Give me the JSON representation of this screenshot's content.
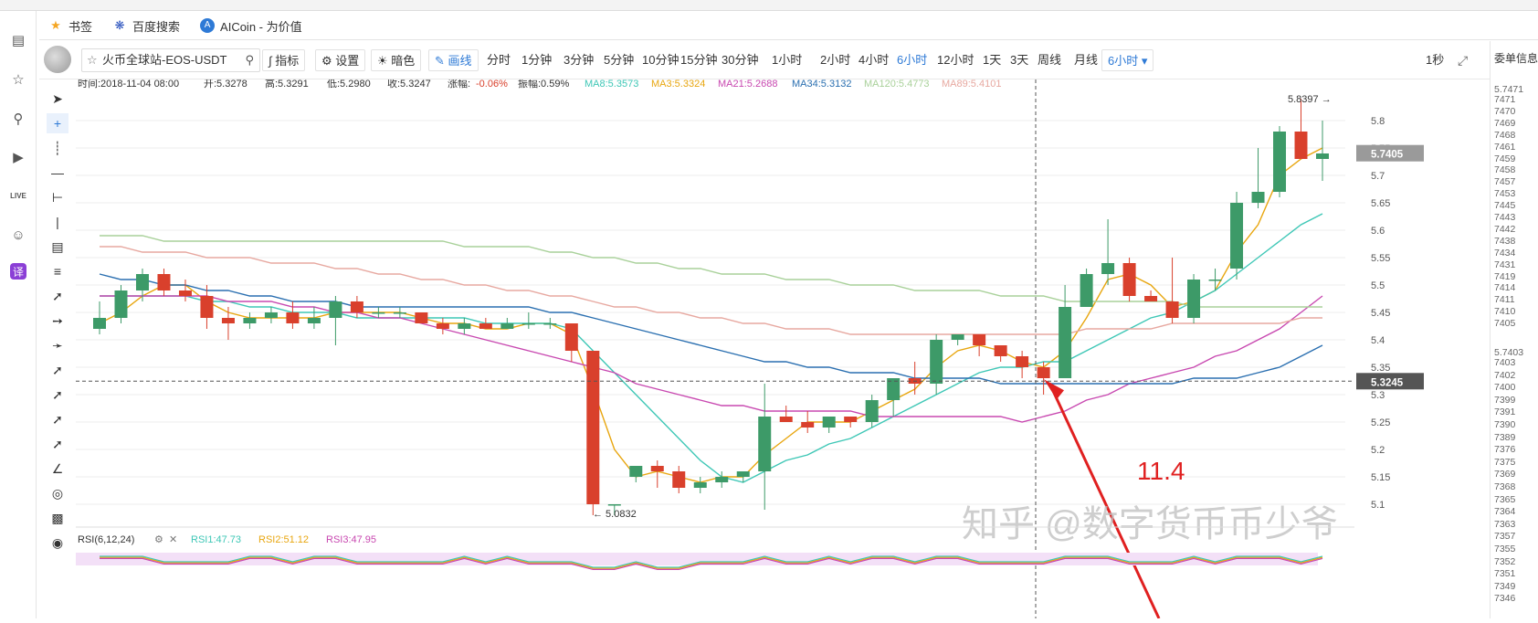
{
  "bookmarks": [
    {
      "label": "书签",
      "icon": "star-icon"
    },
    {
      "label": "百度搜索",
      "icon": "baidu-paw-icon"
    },
    {
      "label": "AICoin - 为价值",
      "icon": "aicoin-logo-icon"
    }
  ],
  "sidebar_icons": [
    "reader-icon",
    "favorites-star-icon",
    "search-icon",
    "video-icon",
    "live-icon",
    "chat-icon",
    "translate-icon"
  ],
  "toolbar": {
    "symbol": "火币全球站-EOS-USDT",
    "indicators": "指标",
    "settings": "设置",
    "theme": "暗色",
    "draw": "画线",
    "intervals": [
      "分时",
      "1分钟",
      "3分钟",
      "5分钟",
      "10分钟",
      "15分钟",
      "30分钟",
      "1小时",
      "2小时",
      "4小时",
      "6小时",
      "12小时",
      "1天",
      "3天",
      "周线",
      "月线"
    ],
    "active_interval": "6小时",
    "interval_dropdown": "6小时",
    "refresh": "1秒"
  },
  "right_panel": {
    "title": "委单信息",
    "sell_values": [
      "7471",
      "7470",
      "7469",
      "7468",
      "7461",
      "7459",
      "7458",
      "7457",
      "7453",
      "7445",
      "7443",
      "7442",
      "7438",
      "7434",
      "7431",
      "7419",
      "7414",
      "7411",
      "7410",
      "7405"
    ],
    "buy_values": [
      "7403",
      "7402",
      "7400",
      "7399",
      "7391",
      "7390",
      "7389",
      "7376",
      "7375",
      "7369",
      "7368",
      "7365",
      "7364",
      "7363",
      "7357",
      "7355",
      "7352",
      "7351",
      "7349",
      "7346"
    ],
    "top_price": "5.7471",
    "mid_price": "5.7403"
  },
  "info_bar": {
    "time": "时间:2018-11-04 08:00",
    "open": "开:5.3278",
    "high": "高:5.3291",
    "low": "低:5.2980",
    "close": "收:5.3247",
    "change_label": "涨幅:",
    "change_value": "-0.06%",
    "amplitude": "振幅:0.59%",
    "ma8": "MA8:5.3573",
    "ma3": "MA3:5.3324",
    "ma21": "MA21:5.2688",
    "ma34": "MA34:5.3132",
    "ma120": "MA120:5.4773",
    "ma89": "MA89:5.4101"
  },
  "annotations": {
    "high_marker": "5.8397 →",
    "low_marker": "← 5.0832",
    "hand_text": "11.4",
    "watermark": "知乎 @数字货币币少爷",
    "last_price": "5.7405",
    "cursor_price": "5.3245"
  },
  "rsi": {
    "label": "RSI(6,12,24)",
    "rsi1": "RSI1:47.73",
    "rsi2": "RSI2:51.12",
    "rsi3": "RSI3:47.95"
  },
  "colors": {
    "up": "#3d9a68",
    "down": "#d9402c",
    "ma3": "#e8a60f",
    "ma8": "#3ec7b6",
    "ma21": "#c848b0",
    "ma34": "#2a6fb0",
    "ma120": "#a9d19a",
    "ma89": "#e7a8a0",
    "arrow": "#e02020",
    "accent": "#2e7ad6"
  },
  "chart_data": {
    "type": "candlestick",
    "symbol": "EOS-USDT",
    "interval": "6小时",
    "y_ticks": [
      "5.8",
      "5.75",
      "5.7",
      "5.65",
      "5.6",
      "5.55",
      "5.5",
      "5.45",
      "5.4",
      "5.35",
      "5.3",
      "5.25",
      "5.2",
      "5.15",
      "5.1"
    ],
    "ylim": [
      5.08,
      5.85
    ],
    "candles": [
      {
        "o": 5.42,
        "h": 5.47,
        "l": 5.41,
        "c": 5.44
      },
      {
        "o": 5.44,
        "h": 5.5,
        "l": 5.43,
        "c": 5.49
      },
      {
        "o": 5.49,
        "h": 5.53,
        "l": 5.47,
        "c": 5.52
      },
      {
        "o": 5.52,
        "h": 5.53,
        "l": 5.48,
        "c": 5.49
      },
      {
        "o": 5.49,
        "h": 5.51,
        "l": 5.47,
        "c": 5.48
      },
      {
        "o": 5.48,
        "h": 5.5,
        "l": 5.42,
        "c": 5.44
      },
      {
        "o": 5.44,
        "h": 5.46,
        "l": 5.4,
        "c": 5.43
      },
      {
        "o": 5.43,
        "h": 5.45,
        "l": 5.42,
        "c": 5.44
      },
      {
        "o": 5.44,
        "h": 5.46,
        "l": 5.43,
        "c": 5.45
      },
      {
        "o": 5.45,
        "h": 5.47,
        "l": 5.42,
        "c": 5.43
      },
      {
        "o": 5.43,
        "h": 5.46,
        "l": 5.42,
        "c": 5.44
      },
      {
        "o": 5.44,
        "h": 5.48,
        "l": 5.39,
        "c": 5.47
      },
      {
        "o": 5.47,
        "h": 5.48,
        "l": 5.44,
        "c": 5.45
      },
      {
        "o": 5.45,
        "h": 5.46,
        "l": 5.44,
        "c": 5.45
      },
      {
        "o": 5.45,
        "h": 5.46,
        "l": 5.44,
        "c": 5.45
      },
      {
        "o": 5.45,
        "h": 5.45,
        "l": 5.43,
        "c": 5.43
      },
      {
        "o": 5.43,
        "h": 5.44,
        "l": 5.41,
        "c": 5.42
      },
      {
        "o": 5.42,
        "h": 5.44,
        "l": 5.41,
        "c": 5.43
      },
      {
        "o": 5.43,
        "h": 5.44,
        "l": 5.42,
        "c": 5.42
      },
      {
        "o": 5.42,
        "h": 5.44,
        "l": 5.42,
        "c": 5.43
      },
      {
        "o": 5.43,
        "h": 5.45,
        "l": 5.42,
        "c": 5.43
      },
      {
        "o": 5.43,
        "h": 5.44,
        "l": 5.42,
        "c": 5.43
      },
      {
        "o": 5.43,
        "h": 5.43,
        "l": 5.36,
        "c": 5.38
      },
      {
        "o": 5.38,
        "h": 5.38,
        "l": 5.08,
        "c": 5.1
      },
      {
        "o": 5.1,
        "h": 5.1,
        "l": 5.08,
        "c": 5.1
      },
      {
        "o": 5.15,
        "h": 5.17,
        "l": 5.14,
        "c": 5.17
      },
      {
        "o": 5.17,
        "h": 5.18,
        "l": 5.13,
        "c": 5.16
      },
      {
        "o": 5.16,
        "h": 5.17,
        "l": 5.12,
        "c": 5.13
      },
      {
        "o": 5.13,
        "h": 5.15,
        "l": 5.12,
        "c": 5.14
      },
      {
        "o": 5.14,
        "h": 5.16,
        "l": 5.13,
        "c": 5.15
      },
      {
        "o": 5.15,
        "h": 5.16,
        "l": 5.14,
        "c": 5.16
      },
      {
        "o": 5.16,
        "h": 5.32,
        "l": 5.09,
        "c": 5.26
      },
      {
        "o": 5.26,
        "h": 5.28,
        "l": 5.25,
        "c": 5.25
      },
      {
        "o": 5.25,
        "h": 5.27,
        "l": 5.23,
        "c": 5.24
      },
      {
        "o": 5.24,
        "h": 5.26,
        "l": 5.23,
        "c": 5.26
      },
      {
        "o": 5.26,
        "h": 5.26,
        "l": 5.24,
        "c": 5.25
      },
      {
        "o": 5.25,
        "h": 5.3,
        "l": 5.24,
        "c": 5.29
      },
      {
        "o": 5.29,
        "h": 5.33,
        "l": 5.26,
        "c": 5.33
      },
      {
        "o": 5.33,
        "h": 5.36,
        "l": 5.3,
        "c": 5.32
      },
      {
        "o": 5.32,
        "h": 5.41,
        "l": 5.3,
        "c": 5.4
      },
      {
        "o": 5.4,
        "h": 5.41,
        "l": 5.39,
        "c": 5.41
      },
      {
        "o": 5.41,
        "h": 5.41,
        "l": 5.37,
        "c": 5.39
      },
      {
        "o": 5.39,
        "h": 5.39,
        "l": 5.36,
        "c": 5.37
      },
      {
        "o": 5.37,
        "h": 5.38,
        "l": 5.33,
        "c": 5.35
      },
      {
        "o": 5.35,
        "h": 5.36,
        "l": 5.3,
        "c": 5.33
      },
      {
        "o": 5.33,
        "h": 5.5,
        "l": 5.33,
        "c": 5.46
      },
      {
        "o": 5.46,
        "h": 5.53,
        "l": 5.46,
        "c": 5.52
      },
      {
        "o": 5.52,
        "h": 5.62,
        "l": 5.5,
        "c": 5.54
      },
      {
        "o": 5.54,
        "h": 5.55,
        "l": 5.47,
        "c": 5.48
      },
      {
        "o": 5.48,
        "h": 5.49,
        "l": 5.47,
        "c": 5.47
      },
      {
        "o": 5.47,
        "h": 5.55,
        "l": 5.43,
        "c": 5.44
      },
      {
        "o": 5.44,
        "h": 5.52,
        "l": 5.43,
        "c": 5.51
      },
      {
        "o": 5.51,
        "h": 5.53,
        "l": 5.49,
        "c": 5.51
      },
      {
        "o": 5.53,
        "h": 5.67,
        "l": 5.51,
        "c": 5.65
      },
      {
        "o": 5.65,
        "h": 5.75,
        "l": 5.64,
        "c": 5.67
      },
      {
        "o": 5.67,
        "h": 5.79,
        "l": 5.66,
        "c": 5.78
      },
      {
        "o": 5.78,
        "h": 5.84,
        "l": 5.73,
        "c": 5.73
      },
      {
        "o": 5.73,
        "h": 5.8,
        "l": 5.69,
        "c": 5.74
      }
    ],
    "ma_lines": [
      {
        "name": "MA3",
        "values": [
          5.43,
          5.45,
          5.48,
          5.5,
          5.5,
          5.47,
          5.45,
          5.44,
          5.44,
          5.44,
          5.44,
          5.45,
          5.45,
          5.45,
          5.45,
          5.44,
          5.43,
          5.43,
          5.42,
          5.42,
          5.43,
          5.43,
          5.41,
          5.31,
          5.2,
          5.15,
          5.16,
          5.15,
          5.14,
          5.15,
          5.15,
          5.19,
          5.22,
          5.25,
          5.25,
          5.25,
          5.27,
          5.29,
          5.31,
          5.35,
          5.38,
          5.39,
          5.38,
          5.36,
          5.35,
          5.38,
          5.44,
          5.51,
          5.52,
          5.5,
          5.46,
          5.47,
          5.49,
          5.56,
          5.61,
          5.7,
          5.73,
          5.75
        ]
      },
      {
        "name": "MA8",
        "values": [
          5.48,
          5.48,
          5.48,
          5.48,
          5.48,
          5.47,
          5.47,
          5.46,
          5.46,
          5.45,
          5.45,
          5.45,
          5.44,
          5.44,
          5.44,
          5.44,
          5.44,
          5.44,
          5.43,
          5.43,
          5.43,
          5.43,
          5.42,
          5.38,
          5.34,
          5.3,
          5.26,
          5.22,
          5.18,
          5.15,
          5.14,
          5.16,
          5.18,
          5.19,
          5.21,
          5.22,
          5.24,
          5.26,
          5.28,
          5.3,
          5.32,
          5.34,
          5.35,
          5.35,
          5.36,
          5.36,
          5.38,
          5.4,
          5.42,
          5.44,
          5.45,
          5.47,
          5.49,
          5.52,
          5.55,
          5.58,
          5.61,
          5.63
        ]
      },
      {
        "name": "MA21",
        "values": [
          5.48,
          5.48,
          5.48,
          5.48,
          5.48,
          5.48,
          5.47,
          5.47,
          5.47,
          5.46,
          5.46,
          5.45,
          5.45,
          5.44,
          5.44,
          5.43,
          5.42,
          5.41,
          5.4,
          5.39,
          5.38,
          5.37,
          5.36,
          5.35,
          5.34,
          5.32,
          5.31,
          5.3,
          5.29,
          5.28,
          5.28,
          5.27,
          5.27,
          5.27,
          5.27,
          5.27,
          5.26,
          5.26,
          5.26,
          5.26,
          5.26,
          5.26,
          5.26,
          5.25,
          5.26,
          5.27,
          5.29,
          5.3,
          5.32,
          5.33,
          5.34,
          5.35,
          5.37,
          5.38,
          5.4,
          5.42,
          5.45,
          5.48
        ]
      },
      {
        "name": "MA34",
        "values": [
          5.52,
          5.51,
          5.51,
          5.5,
          5.5,
          5.49,
          5.49,
          5.48,
          5.48,
          5.47,
          5.47,
          5.47,
          5.46,
          5.46,
          5.46,
          5.46,
          5.46,
          5.46,
          5.46,
          5.46,
          5.46,
          5.45,
          5.45,
          5.44,
          5.43,
          5.42,
          5.41,
          5.4,
          5.39,
          5.38,
          5.37,
          5.36,
          5.36,
          5.35,
          5.35,
          5.34,
          5.34,
          5.34,
          5.33,
          5.33,
          5.33,
          5.33,
          5.32,
          5.32,
          5.32,
          5.32,
          5.32,
          5.32,
          5.32,
          5.32,
          5.32,
          5.33,
          5.33,
          5.33,
          5.34,
          5.35,
          5.37,
          5.39
        ]
      },
      {
        "name": "MA120",
        "values": [
          5.59,
          5.59,
          5.59,
          5.58,
          5.58,
          5.58,
          5.58,
          5.58,
          5.58,
          5.58,
          5.58,
          5.58,
          5.58,
          5.58,
          5.58,
          5.58,
          5.58,
          5.57,
          5.57,
          5.57,
          5.57,
          5.56,
          5.56,
          5.55,
          5.55,
          5.54,
          5.54,
          5.53,
          5.53,
          5.52,
          5.52,
          5.52,
          5.51,
          5.51,
          5.51,
          5.5,
          5.5,
          5.5,
          5.49,
          5.49,
          5.49,
          5.49,
          5.48,
          5.48,
          5.48,
          5.47,
          5.47,
          5.47,
          5.47,
          5.47,
          5.47,
          5.46,
          5.46,
          5.46,
          5.46,
          5.46,
          5.46,
          5.46
        ]
      },
      {
        "name": "MA89",
        "values": [
          5.57,
          5.57,
          5.56,
          5.56,
          5.56,
          5.55,
          5.55,
          5.55,
          5.54,
          5.54,
          5.54,
          5.53,
          5.53,
          5.52,
          5.52,
          5.51,
          5.51,
          5.5,
          5.5,
          5.49,
          5.49,
          5.48,
          5.48,
          5.47,
          5.46,
          5.46,
          5.45,
          5.45,
          5.44,
          5.44,
          5.43,
          5.43,
          5.42,
          5.42,
          5.42,
          5.41,
          5.41,
          5.41,
          5.41,
          5.41,
          5.41,
          5.41,
          5.41,
          5.41,
          5.41,
          5.41,
          5.42,
          5.42,
          5.42,
          5.42,
          5.43,
          5.43,
          5.43,
          5.43,
          5.43,
          5.43,
          5.44,
          5.44
        ]
      }
    ]
  }
}
